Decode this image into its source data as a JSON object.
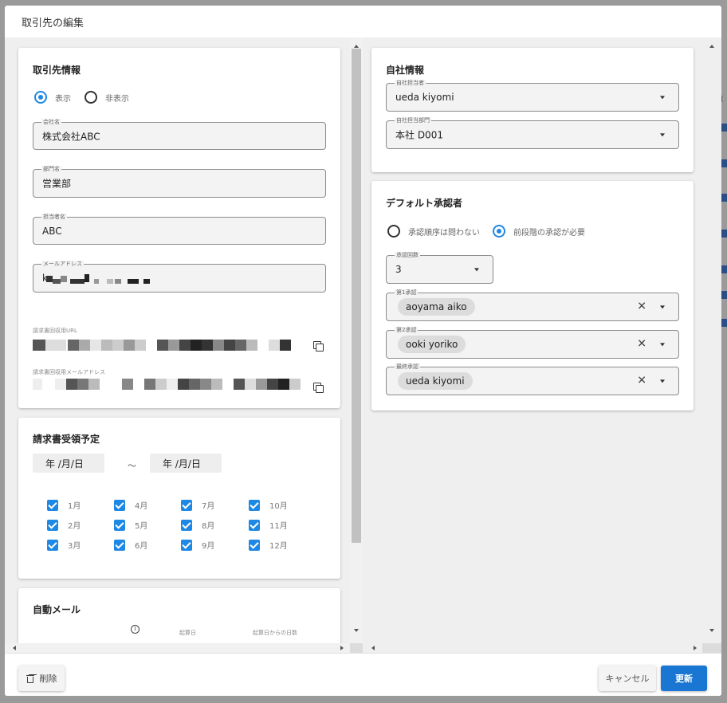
{
  "dialog": {
    "title": "取引先の編集"
  },
  "client_info": {
    "title": "取引先情報",
    "visibility": {
      "options": [
        "表示",
        "非表示"
      ],
      "selected": "表示"
    },
    "company_name": {
      "label": "会社名",
      "value": "株式会社ABC"
    },
    "department": {
      "label": "部門名",
      "value": "営業部"
    },
    "contact_name": {
      "label": "担当者名",
      "value": "ABC"
    },
    "email": {
      "label": "メールアドレス",
      "value": "k"
    },
    "invoice_url": {
      "label": "請求書回収用URL"
    },
    "invoice_email": {
      "label": "請求書回収用メールアドレス"
    }
  },
  "invoice_schedule": {
    "title": "請求書受領予定",
    "date_from_placeholder": "年 /月/日",
    "date_to_placeholder": "年 /月/日",
    "separator": "～",
    "months": [
      {
        "label": "1月",
        "checked": true
      },
      {
        "label": "4月",
        "checked": true
      },
      {
        "label": "7月",
        "checked": true
      },
      {
        "label": "10月",
        "checked": true
      },
      {
        "label": "2月",
        "checked": true
      },
      {
        "label": "5月",
        "checked": true
      },
      {
        "label": "8月",
        "checked": true
      },
      {
        "label": "11月",
        "checked": true
      },
      {
        "label": "3月",
        "checked": true
      },
      {
        "label": "6月",
        "checked": true
      },
      {
        "label": "9月",
        "checked": true
      },
      {
        "label": "12月",
        "checked": true
      }
    ]
  },
  "auto_mail": {
    "title": "自動メール",
    "col_base_date": "起算日",
    "col_days_from_base": "起算日からの日数",
    "info_icon": "i"
  },
  "company_info": {
    "title": "自社情報",
    "owner": {
      "label": "自社担当者",
      "value": "ueda kiyomi"
    },
    "department": {
      "label": "自社担当部門",
      "value": "本社 D001"
    }
  },
  "default_approvers": {
    "title": "デフォルト承認者",
    "order": {
      "options": [
        "承認順序は問わない",
        "前段階の承認が必要"
      ],
      "selected": "前段階の承認が必要"
    },
    "approval_count": {
      "label": "承認回数",
      "value": "3"
    },
    "approver_1": {
      "label": "第1承認",
      "value": "aoyama aiko"
    },
    "approver_2": {
      "label": "第2承認",
      "value": "ooki yoriko"
    },
    "approver_final": {
      "label": "最終承認",
      "value": "ueda kiyomi"
    }
  },
  "footer": {
    "delete_label": "削除",
    "cancel_label": "キャンセル",
    "update_label": "更新"
  },
  "colors": {
    "primary": "#1976d2",
    "checkbox": "#1e88e5",
    "body_bg": "#efefef"
  }
}
